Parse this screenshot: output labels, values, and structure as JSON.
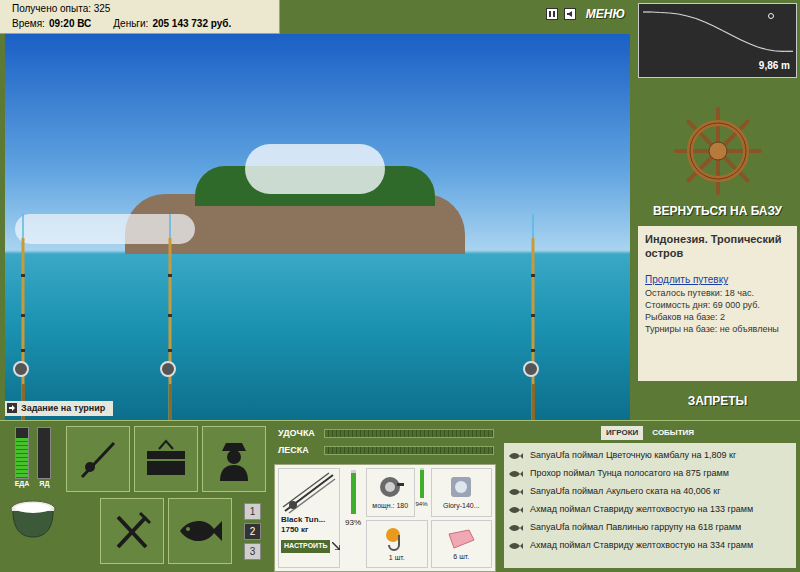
{
  "hud": {
    "experience": "Получено опыта: 325",
    "time_label": "Время:",
    "time": "09:20 ВС",
    "money_label": "Деньги:",
    "money": "205 143 732 руб."
  },
  "menu": {
    "label": "МЕНЮ"
  },
  "depth": {
    "reading": "9,86 m",
    "values": [
      2.0,
      2.0,
      2.1,
      2.2,
      2.4,
      2.8,
      3.3,
      4.0,
      4.8,
      5.7,
      6.6,
      7.5,
      8.3,
      9.0,
      9.5,
      9.8,
      9.86,
      9.86
    ]
  },
  "tournament_task": "Задание на турнир",
  "base": {
    "return": "ВЕРНУТЬСЯ НА БАЗУ",
    "location": "Индонезия. Тропический остров",
    "extend": "Продлить путевку",
    "lines": [
      "Осталось путевки: 18 час.",
      "Стоимость дня: 69 000 руб.",
      "Рыбаков на базе: 2",
      "Турниры на базе: не объявлены"
    ],
    "bans": "ЗАПРЕТЫ"
  },
  "meters": [
    {
      "label": "ЕДА",
      "level": 0.8
    },
    {
      "label": "ЯД",
      "level": 0
    }
  ],
  "slots": [
    {
      "label": "1",
      "selected": false
    },
    {
      "label": "2",
      "selected": true
    },
    {
      "label": "3",
      "selected": false
    }
  ],
  "tension": [
    {
      "label": "УДОЧКА",
      "level": 0
    },
    {
      "label": "ЛЕСКА",
      "level": 0
    }
  ],
  "tackle": {
    "rod": {
      "name": "Black Tun...",
      "capacity": "1750 кг",
      "wear": "93%",
      "level": 0.93,
      "button": "НАСТРОИТЬ"
    },
    "reel": {
      "power": "мощн.: 180",
      "wear": "94%",
      "level": 0.94
    },
    "line": {
      "name": "Glory-140..."
    },
    "hook": {
      "count": "1 шт."
    },
    "bait": {
      "count": "6 шт."
    }
  },
  "log": {
    "tabs": [
      {
        "label": "ИГРОКИ",
        "selected": true
      },
      {
        "label": "СОБЫТИЯ",
        "selected": false
      }
    ],
    "entries": [
      {
        "text": "SanyaUfa поймал Цветочную камбалу на 1,809 кг"
      },
      {
        "text": "Прохор поймал Тунца полосатого на 875 грамм"
      },
      {
        "text": "SanyaUfa поймал Акульего ската на 40,006 кг"
      },
      {
        "text": "Ахмад поймал Ставриду желтохвостую на 133 грамм"
      },
      {
        "text": "SanyaUfa поймал Павлинью гаррупу на 618 грамм"
      },
      {
        "text": "Ахмад поймал Ставриду желтохвостую на 334 грамм"
      }
    ]
  }
}
